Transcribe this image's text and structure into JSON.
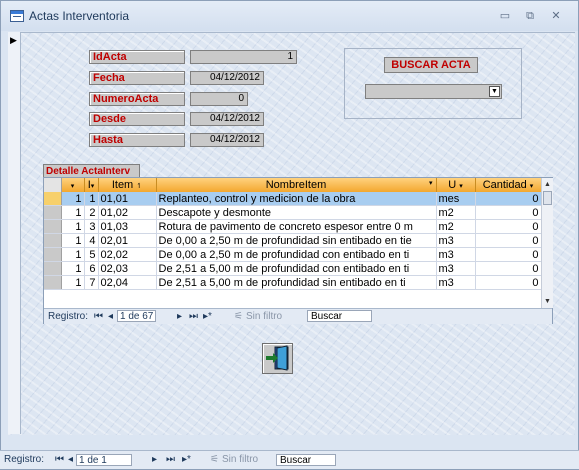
{
  "window": {
    "title": "Actas Interventoria",
    "minimize_icon": "minimize-icon",
    "restore_icon": "restore-icon",
    "close_icon": "close-icon"
  },
  "fields": {
    "idacta": {
      "label": "IdActa",
      "value": "1"
    },
    "fecha": {
      "label": "Fecha",
      "value": "04/12/2012"
    },
    "numeroacta": {
      "label": "NumeroActa",
      "value": "0"
    },
    "desde": {
      "label": "Desde",
      "value": "04/12/2012"
    },
    "hasta": {
      "label": "Hasta",
      "value": "04/12/2012"
    }
  },
  "search": {
    "button_label": "BUSCAR ACTA",
    "combo_value": ""
  },
  "subform": {
    "label": "Detalle ActaInterv",
    "columns": [
      "I",
      "Item",
      "NombreItem",
      "U",
      "Cantidad"
    ],
    "rows": [
      {
        "i": "1",
        "item": "01,01",
        "nombre": "Replanteo, control y medicion de la obra",
        "u": "mes",
        "cantidad": "0"
      },
      {
        "i": "2",
        "item": "01,02",
        "nombre": "Descapote y desmonte",
        "u": "m2",
        "cantidad": "0"
      },
      {
        "i": "3",
        "item": "01,03",
        "nombre": "Rotura de pavimento de concreto espesor entre 0 m",
        "u": "m2",
        "cantidad": "0"
      },
      {
        "i": "4",
        "item": "02,01",
        "nombre": "De 0,00 a 2,50 m de profundidad sin entibado en tie",
        "u": "m3",
        "cantidad": "0"
      },
      {
        "i": "5",
        "item": "02,02",
        "nombre": "De 0,00 a 2,50 m de profundidad con entibado en ti",
        "u": "m3",
        "cantidad": "0"
      },
      {
        "i": "6",
        "item": "02,03",
        "nombre": "De 2,51 a 5,00 m de profundidad con entibado en ti",
        "u": "m3",
        "cantidad": "0"
      },
      {
        "i": "7",
        "item": "02,04",
        "nombre": "De 2,51 a 5,00 m de profundidad sin entibado  en ti",
        "u": "m3",
        "cantidad": "0"
      }
    ],
    "first_col_value": "1",
    "navbar": {
      "label": "Registro:",
      "position": "1 de 67",
      "filter": "Sin filtro",
      "search": "Buscar"
    }
  },
  "main_navbar": {
    "label": "Registro:",
    "position": "1 de 1",
    "filter": "Sin filtro",
    "search": "Buscar"
  },
  "exit_button_icon": "exit-door-icon"
}
